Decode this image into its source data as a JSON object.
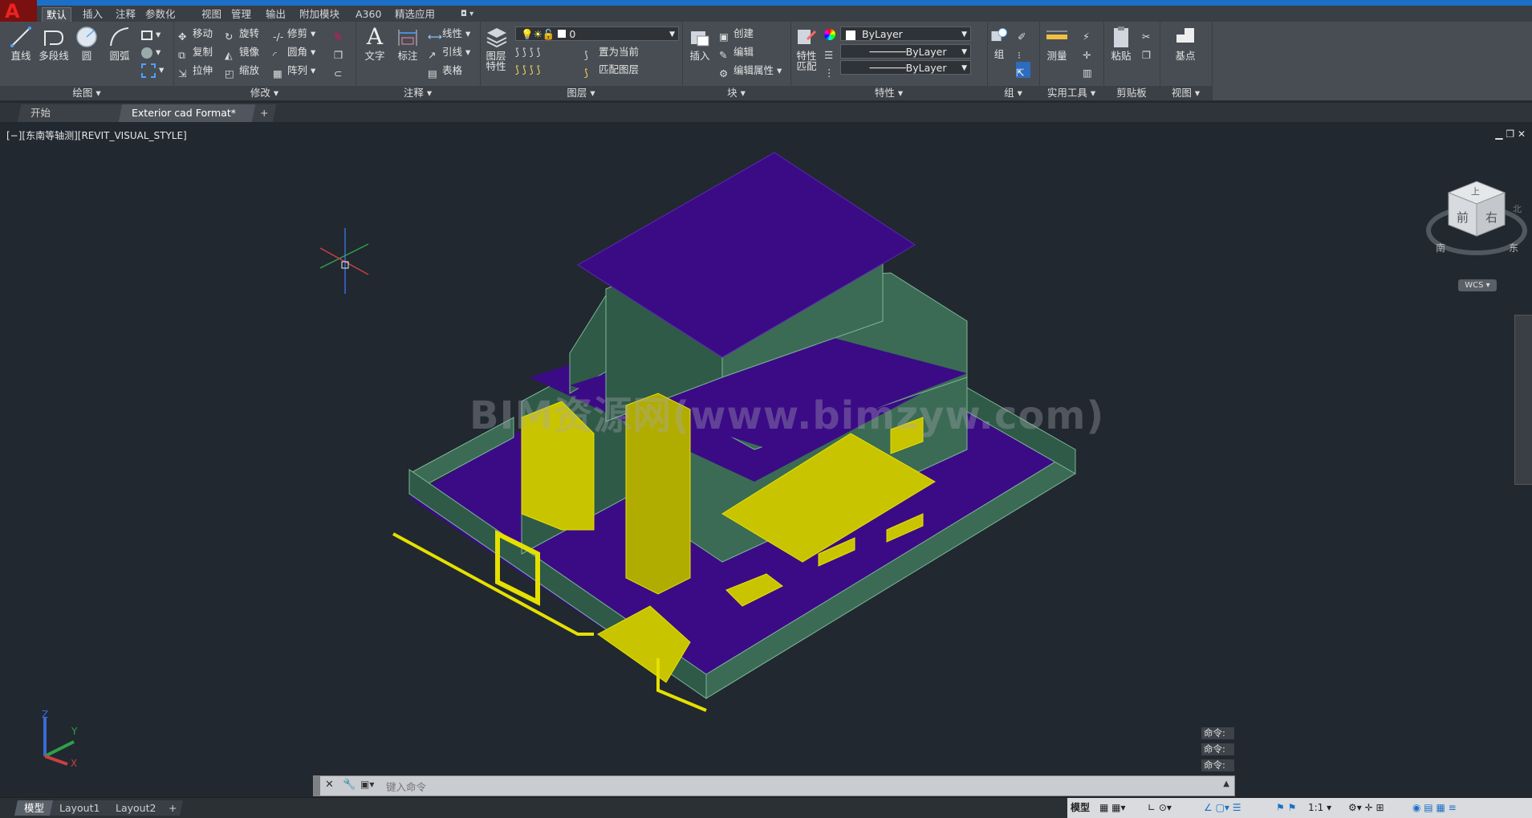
{
  "app": {
    "logo_text": "A"
  },
  "ribbon_tabs": [
    "默认",
    "插入",
    "注释",
    "参数化",
    "视图",
    "管理",
    "输出",
    "附加模块",
    "A360",
    "精选应用"
  ],
  "panels": {
    "draw": {
      "title": "绘图",
      "line": "直线",
      "polyline": "多段线",
      "circle": "圆",
      "arc": "圆弧"
    },
    "modify": {
      "title": "修改",
      "move": "移动",
      "rotate": "旋转",
      "trim": "修剪",
      "copy": "复制",
      "mirror": "镜像",
      "fillet": "圆角",
      "stretch": "拉伸",
      "scale": "缩放",
      "array": "阵列"
    },
    "annotation": {
      "title": "注释",
      "text": "文字",
      "dimension": "标注",
      "linear": "线性",
      "leader": "引线",
      "table": "表格"
    },
    "layers": {
      "title": "图层",
      "layer_props": "图层\n特性",
      "layer_value": "0",
      "make_current": "置为当前",
      "match_layer": "匹配图层"
    },
    "block": {
      "title": "块",
      "insert": "插入",
      "create": "创建",
      "edit": "编辑",
      "edit_attr": "编辑属性"
    },
    "properties": {
      "title": "特性",
      "match": "特性\n匹配",
      "color": "ByLayer",
      "linetype": "ByLayer",
      "lineweight": "ByLayer"
    },
    "groups": {
      "title": "组",
      "group": "组"
    },
    "utilities": {
      "title": "实用工具",
      "measure": "测量"
    },
    "clipboard": {
      "title": "剪贴板",
      "paste": "粘贴"
    },
    "view": {
      "title": "视图",
      "base": "基点"
    }
  },
  "doc_tabs": {
    "start": "开始",
    "active": "Exterior cad Format*",
    "add": "+"
  },
  "viewport": {
    "label": "[−][东南等轴测][REVIT_VISUAL_STYLE]",
    "watermark": "BIM资源网(www.bimzyw.com)",
    "viewcube": {
      "top": "上",
      "front": "前",
      "right": "右",
      "south": "南",
      "east": "东",
      "north": "北",
      "wcs": "WCS"
    },
    "ucs": {
      "x": "X",
      "y": "Y",
      "z": "Z"
    }
  },
  "command": {
    "history": [
      "命令:",
      "命令:",
      "命令:"
    ],
    "placeholder": "键入命令"
  },
  "status": {
    "model_tab": "模型",
    "layout1": "Layout1",
    "layout2": "Layout2",
    "add": "+",
    "model": "模型",
    "scale": "1:1"
  },
  "colors": {
    "accent": "#1c6fc6",
    "roof": "#3b0b86",
    "walls": "#3b6b55",
    "yellow": "#c9c400",
    "ribbon": "#484d53",
    "viewport_bg": "#212830"
  }
}
